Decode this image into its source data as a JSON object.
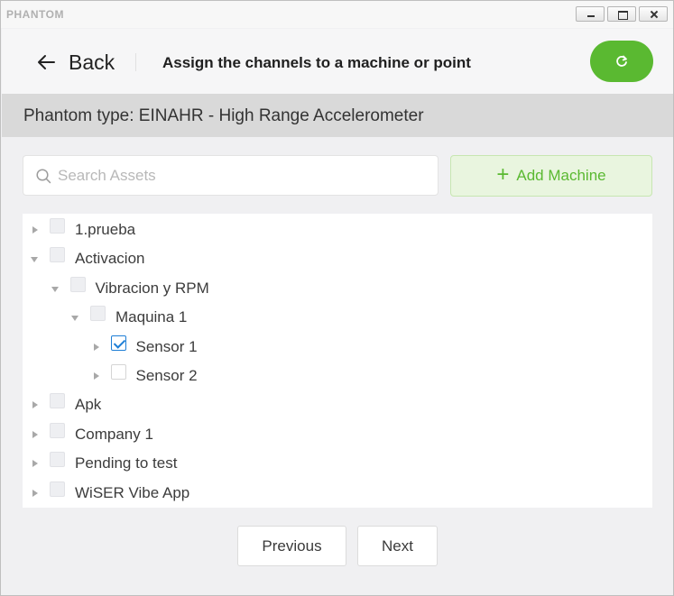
{
  "window": {
    "title": "PHANTOM"
  },
  "header": {
    "back_label": "Back",
    "title": "Assign the channels to a machine or point"
  },
  "phantom_type": "Phantom type: EINAHR - High Range Accelerometer",
  "search": {
    "placeholder": "Search Assets",
    "value": ""
  },
  "add_machine_label": "Add Machine",
  "tree": [
    {
      "label": "1.prueba",
      "depth": 0,
      "expanded": false,
      "checked": false,
      "disabled": true
    },
    {
      "label": "Activacion",
      "depth": 0,
      "expanded": true,
      "checked": false,
      "disabled": true
    },
    {
      "label": "Vibracion y RPM",
      "depth": 1,
      "expanded": true,
      "checked": false,
      "disabled": true
    },
    {
      "label": "Maquina 1",
      "depth": 2,
      "expanded": true,
      "checked": false,
      "disabled": true
    },
    {
      "label": "Sensor 1",
      "depth": 3,
      "expanded": false,
      "checked": true,
      "disabled": false
    },
    {
      "label": "Sensor 2",
      "depth": 3,
      "expanded": false,
      "checked": false,
      "disabled": false
    },
    {
      "label": "Apk",
      "depth": 0,
      "expanded": false,
      "checked": false,
      "disabled": true
    },
    {
      "label": "Company 1",
      "depth": 0,
      "expanded": false,
      "checked": false,
      "disabled": true
    },
    {
      "label": "Pending to test",
      "depth": 0,
      "expanded": false,
      "checked": false,
      "disabled": true
    },
    {
      "label": "WiSER Vibe App",
      "depth": 0,
      "expanded": false,
      "checked": false,
      "disabled": true
    }
  ],
  "footer": {
    "previous_label": "Previous",
    "next_label": "Next"
  },
  "colors": {
    "accent_green": "#5ab931",
    "check_blue": "#1f7fd6",
    "type_bar": "#d9d9d9"
  }
}
